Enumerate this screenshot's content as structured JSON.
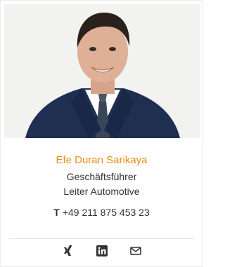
{
  "contact": {
    "name": "Efe Duran Sarikaya",
    "role_line1": "Geschäftsführer",
    "role_line2": "Leiter Automotive",
    "phone_prefix": "T",
    "phone": "+49 211 875 453 23"
  },
  "social": {
    "icons": [
      "xing-icon",
      "linkedin-icon",
      "mail-icon"
    ]
  },
  "colors": {
    "name": "#e88c1a",
    "text": "#333333",
    "photo_bg": "#f3f3f3"
  }
}
